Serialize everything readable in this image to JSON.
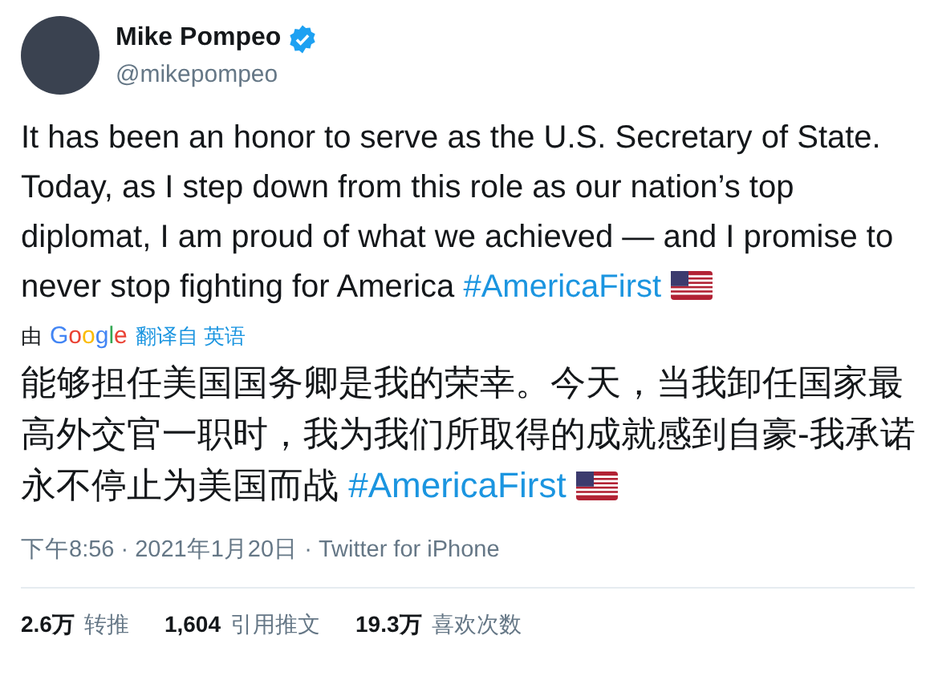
{
  "author": {
    "name": "Mike Pompeo",
    "handle": "@mikepompeo",
    "verified": true
  },
  "tweet": {
    "text": "It has been an honor to serve as the U.S. Secretary of State. Today, as I step down from this role as our nation’s top diplomat, I am proud of what we achieved — and I promise to never stop fighting for America",
    "hashtag": "#AmericaFirst"
  },
  "translation_note": {
    "prefix": "由",
    "brand": "Google",
    "link": "翻译自 英语"
  },
  "translation": {
    "text": "能够担任美国国务卿是我的荣幸。今天，当我卸任国家最高外交官一职时，我为我们所取得的成就感到自豪-我承诺永不停止为美国而战",
    "hashtag": "#AmericaFirst"
  },
  "meta": "下午8:56 · 2021年1月20日 · Twitter for iPhone",
  "stats": [
    {
      "count": "2.6万",
      "label": "转推"
    },
    {
      "count": "1,604",
      "label": "引用推文"
    },
    {
      "count": "19.3万",
      "label": "喜欢次数"
    }
  ]
}
